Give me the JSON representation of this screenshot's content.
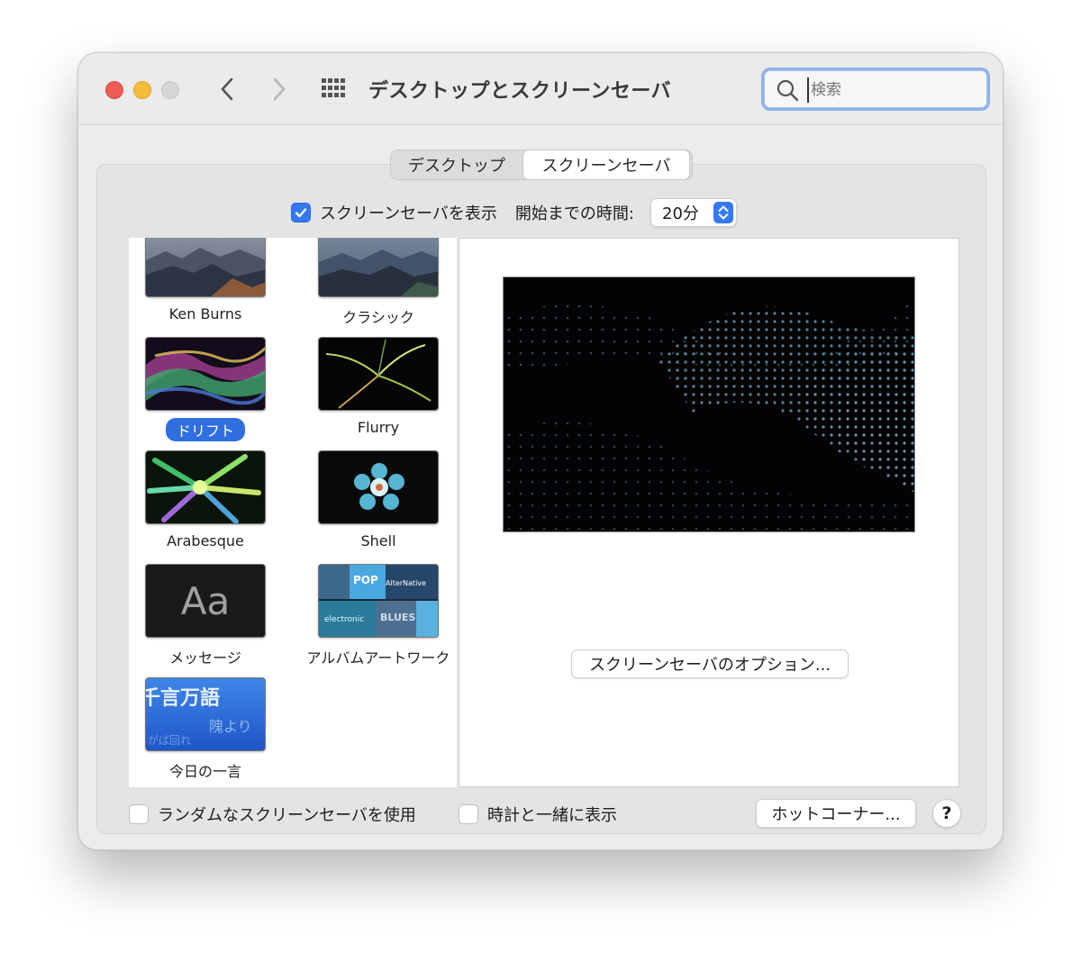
{
  "window": {
    "title": "デスクトップとスクリーンセーバ",
    "search_placeholder": "検索"
  },
  "tabs": [
    {
      "label": "デスクトップ",
      "selected": false
    },
    {
      "label": "スクリーンセーバ",
      "selected": true
    }
  ],
  "show_saver": {
    "label": "スクリーンセーバを表示",
    "checked": true
  },
  "start_time": {
    "label": "開始までの時間:",
    "value": "20分"
  },
  "savers": [
    {
      "label": "Ken Burns",
      "selected": false,
      "icon": "mountain-thumbnail"
    },
    {
      "label": "クラシック",
      "selected": false,
      "icon": "mountain-thumbnail"
    },
    {
      "label": "ドリフト",
      "selected": true,
      "icon": "drift-thumbnail"
    },
    {
      "label": "Flurry",
      "selected": false,
      "icon": "flurry-thumbnail"
    },
    {
      "label": "Arabesque",
      "selected": false,
      "icon": "arabesque-thumbnail"
    },
    {
      "label": "Shell",
      "selected": false,
      "icon": "shell-thumbnail"
    },
    {
      "label": "メッセージ",
      "selected": false,
      "icon": "message-thumbnail",
      "thumb_text": "Aa"
    },
    {
      "label": "アルバムアートワーク",
      "selected": false,
      "icon": "album-artwork-thumbnail",
      "thumb_words": [
        "POP",
        "AlterNative",
        "electronic",
        "BLUES"
      ]
    },
    {
      "label": "今日の一言",
      "selected": false,
      "icon": "word-of-day-thumbnail",
      "thumb_lines": [
        "千言万語",
        "隗より",
        "がば回れ"
      ]
    }
  ],
  "preview": {
    "options_button": "スクリーンセーバのオプション..."
  },
  "bottom": {
    "random_label": "ランダムなスクリーンセーバを使用",
    "random_checked": false,
    "clock_label": "時計と一緒に表示",
    "clock_checked": false,
    "hot_corners_button": "ホットコーナー...",
    "help_button": "?"
  },
  "colors": {
    "accent": "#3478f6",
    "selection": "#2f6fe0"
  }
}
